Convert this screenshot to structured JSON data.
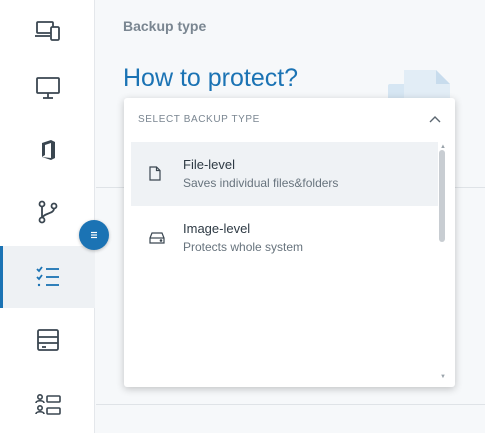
{
  "sidebar": {
    "items": [
      {
        "icon": "devices-icon",
        "active": false
      },
      {
        "icon": "monitor-icon",
        "active": false
      },
      {
        "icon": "office-icon",
        "active": false
      },
      {
        "icon": "branch-icon",
        "active": false
      },
      {
        "icon": "checklist-icon",
        "active": true
      },
      {
        "icon": "server-icon",
        "active": false
      },
      {
        "icon": "user-list-icon",
        "active": false
      }
    ],
    "collapse_icon": "menu-icon"
  },
  "main": {
    "section_label": "Backup type",
    "title": "How to protect?"
  },
  "dropdown": {
    "header": "SELECT BACKUP TYPE",
    "header_icon": "chevron-up-icon",
    "options": [
      {
        "title": "File-level",
        "description": "Saves individual files&folders",
        "icon": "file-icon"
      },
      {
        "title": "Image-level",
        "description": "Protects whole system",
        "icon": "drive-icon"
      }
    ]
  },
  "colors": {
    "accent": "#1b73b4",
    "icon_dark": "#3a4650",
    "muted_text": "#7a8691"
  }
}
